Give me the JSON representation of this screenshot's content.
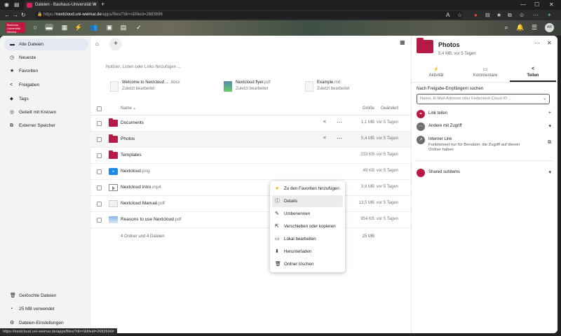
{
  "browser": {
    "tab_title": "Dateien - Bauhaus-Universität W",
    "url_prefix": "https://",
    "url_host": "nextcloud.uni-weimar.de",
    "url_path": "/apps/files/?dir=/&fileid=2683696",
    "status_url": "https://nextcloud.uni-weimar.de/apps/files/?dir=/&fileid=2683696#"
  },
  "header": {
    "logo_text": "Bauhaus-Universität Weimar",
    "avatar_initials": "AR"
  },
  "navigation": {
    "items": [
      {
        "label": "Alle Dateien",
        "icon": "folder-icon"
      },
      {
        "label": "Neueste",
        "icon": "clock-icon"
      },
      {
        "label": "Favoriten",
        "icon": "star-icon"
      },
      {
        "label": "Freigaben",
        "icon": "share-icon"
      },
      {
        "label": "Tags",
        "icon": "tag-icon"
      },
      {
        "label": "Geteilt mit Kreisen",
        "icon": "circles-icon"
      },
      {
        "label": "Externer Speicher",
        "icon": "external-storage-icon"
      }
    ],
    "footer": [
      {
        "label": "Gelöschte Dateien",
        "icon": "trash-icon"
      },
      {
        "label": "25 MB verwendet",
        "icon": "pie-icon"
      },
      {
        "label": "Dateien-Einstellungen",
        "icon": "gear-icon"
      }
    ]
  },
  "main": {
    "filter_placeholder": "Notizen, Listen oder Links hinzufügen ...",
    "recent": [
      {
        "name": "Welcome to Nextcloud ...",
        "ext": ".docx",
        "subtitle": "Zuletzt bearbeitet"
      },
      {
        "name": "Nextcloud flyer",
        "ext": ".pdf",
        "subtitle": "Zuletzt bearbeitet"
      },
      {
        "name": "Example",
        "ext": ".md",
        "subtitle": "Zuletzt bearbeitet"
      }
    ],
    "columns": {
      "name": "Name",
      "sort_arrow": "▲",
      "size": "Größe",
      "modified": "Geändert"
    },
    "files": [
      {
        "name": "Documents",
        "ext": "",
        "type": "folder",
        "size": "1,1 MB",
        "modified": "vor 5 Tagen"
      },
      {
        "name": "Photos",
        "ext": "",
        "type": "folder",
        "size": "5,4 MB",
        "modified": "vor 5 Tagen"
      },
      {
        "name": "Templates",
        "ext": "",
        "type": "folder",
        "size": "233 KB",
        "modified": "vor 5 Tagen"
      },
      {
        "name": "Nextcloud",
        "ext": ".png",
        "type": "png",
        "size": "49 KB",
        "modified": "vor 5 Tagen"
      },
      {
        "name": "Nextcloud intro",
        "ext": ".mp4",
        "type": "video",
        "size": "3,8 MB",
        "modified": "vor 5 Tagen"
      },
      {
        "name": "Nextcloud Manual",
        "ext": ".pdf",
        "type": "pdf",
        "size": "13,5 MB",
        "modified": "vor 5 Tagen"
      },
      {
        "name": "Reasons to use Nextcloud",
        "ext": ".pdf",
        "type": "image",
        "size": "954 KB",
        "modified": "vor 5 Tagen"
      }
    ],
    "summary_count": "4 Ordner und 4 Dateien",
    "summary_size": "25 MB",
    "png_icon_text": "∞"
  },
  "context_menu": {
    "items": [
      {
        "label": "Zu den Favoriten hinzufügen",
        "icon": "star-icon"
      },
      {
        "label": "Details",
        "icon": "info-icon"
      },
      {
        "label": "Umbenennen",
        "icon": "pencil-icon"
      },
      {
        "label": "Verschieben oder kopieren",
        "icon": "move-icon"
      },
      {
        "label": "Lokal bearbeiten",
        "icon": "laptop-icon"
      },
      {
        "label": "Herunterladen",
        "icon": "download-icon"
      },
      {
        "label": "Ordner löschen",
        "icon": "trash-icon"
      }
    ]
  },
  "sidebar": {
    "title": "Photos",
    "subtitle": "5,4 MB, vor 5 Tagen",
    "tabs": [
      {
        "label": "Aktivität",
        "icon": "lightning-icon"
      },
      {
        "label": "Kommentare",
        "icon": "comment-icon"
      },
      {
        "label": "Teilen",
        "icon": "share-icon"
      }
    ],
    "share_label": "Nach Freigabe-Empfängern suchen",
    "share_placeholder": "Name, E-Mail-Adresse oder Federated-Cloud-ID ...",
    "link_share": "Link teilen",
    "others_access": "Andere mit Zugriff",
    "internal_link": "Interner Link",
    "internal_link_desc": "Funktioniert nur für Benutzer, die Zugriff auf diesen Ordner haben",
    "shared_subitems": "Shared subitems"
  }
}
